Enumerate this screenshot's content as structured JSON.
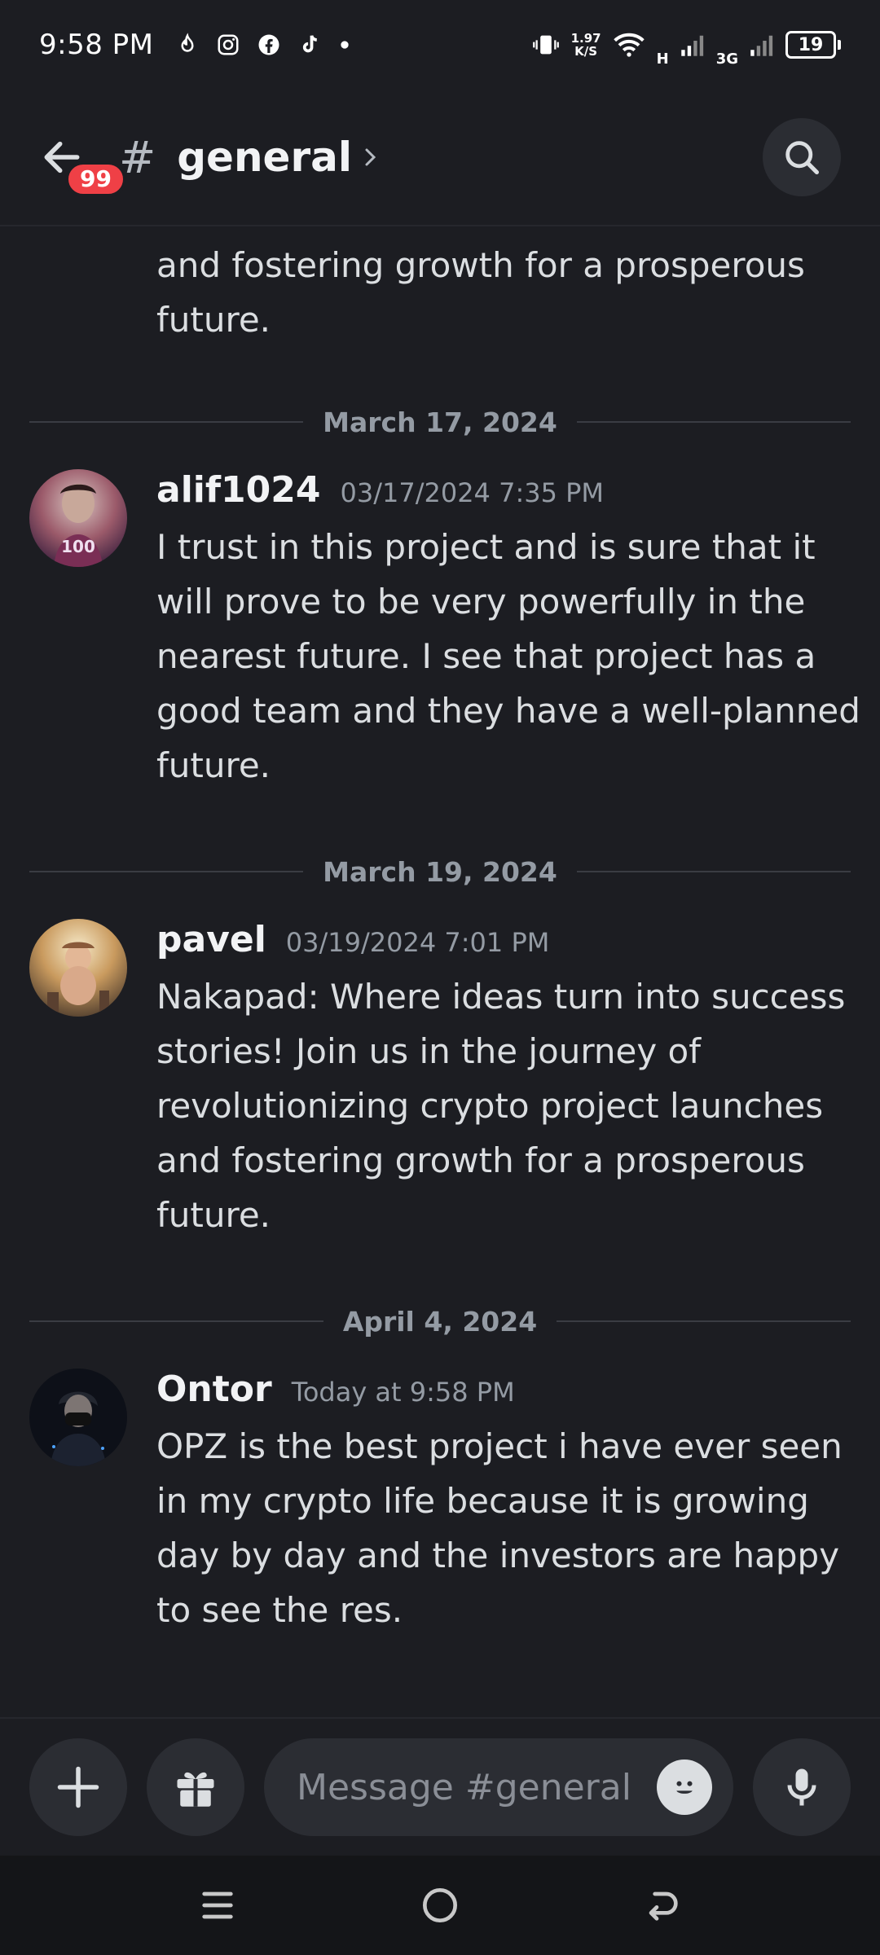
{
  "status_bar": {
    "time": "9:58 PM",
    "net_speed_value": "1.97",
    "net_speed_unit": "K/S",
    "battery": "19",
    "network_label_1": "H",
    "network_label_2": "3G"
  },
  "header": {
    "badge_count": "99",
    "hash": "#",
    "channel_name": "general"
  },
  "messages": {
    "tail_text": "and fostering growth for a prosperous future.",
    "dividers": [
      {
        "date": "March 17, 2024"
      },
      {
        "date": "March 19, 2024"
      },
      {
        "date": "April 4, 2024"
      }
    ],
    "items": [
      {
        "author": "alif1024",
        "timestamp": "03/17/2024 7:35 PM",
        "text": "I trust in this project and is sure that it will prove to be very powerfully in the nearest future. I see that project has a good team and they have a well-planned future.",
        "avatar_label": "100"
      },
      {
        "author": "pavel",
        "timestamp": "03/19/2024 7:01 PM",
        "text": "Nakapad: Where ideas turn into success stories! Join us in the journey of revolutionizing crypto project launches and fostering growth for a prosperous future."
      },
      {
        "author": "Ontor",
        "timestamp": "Today at 9:58 PM",
        "text": "OPZ is the best project i have ever seen in my crypto life because it is growing day by day and the investors are happy to see the res."
      }
    ]
  },
  "composer": {
    "placeholder": "Message #general"
  },
  "icons": {
    "back": "back-arrow-icon",
    "search": "search-icon",
    "add": "plus-icon",
    "gift": "gift-icon",
    "emoji": "emoji-icon",
    "mic": "microphone-icon",
    "nav_menu": "menu-icon",
    "nav_home": "home-icon",
    "nav_back": "back-icon"
  },
  "colors": {
    "background": "#1c1d22",
    "badge": "#ef4046",
    "surface": "#2b2d33"
  }
}
